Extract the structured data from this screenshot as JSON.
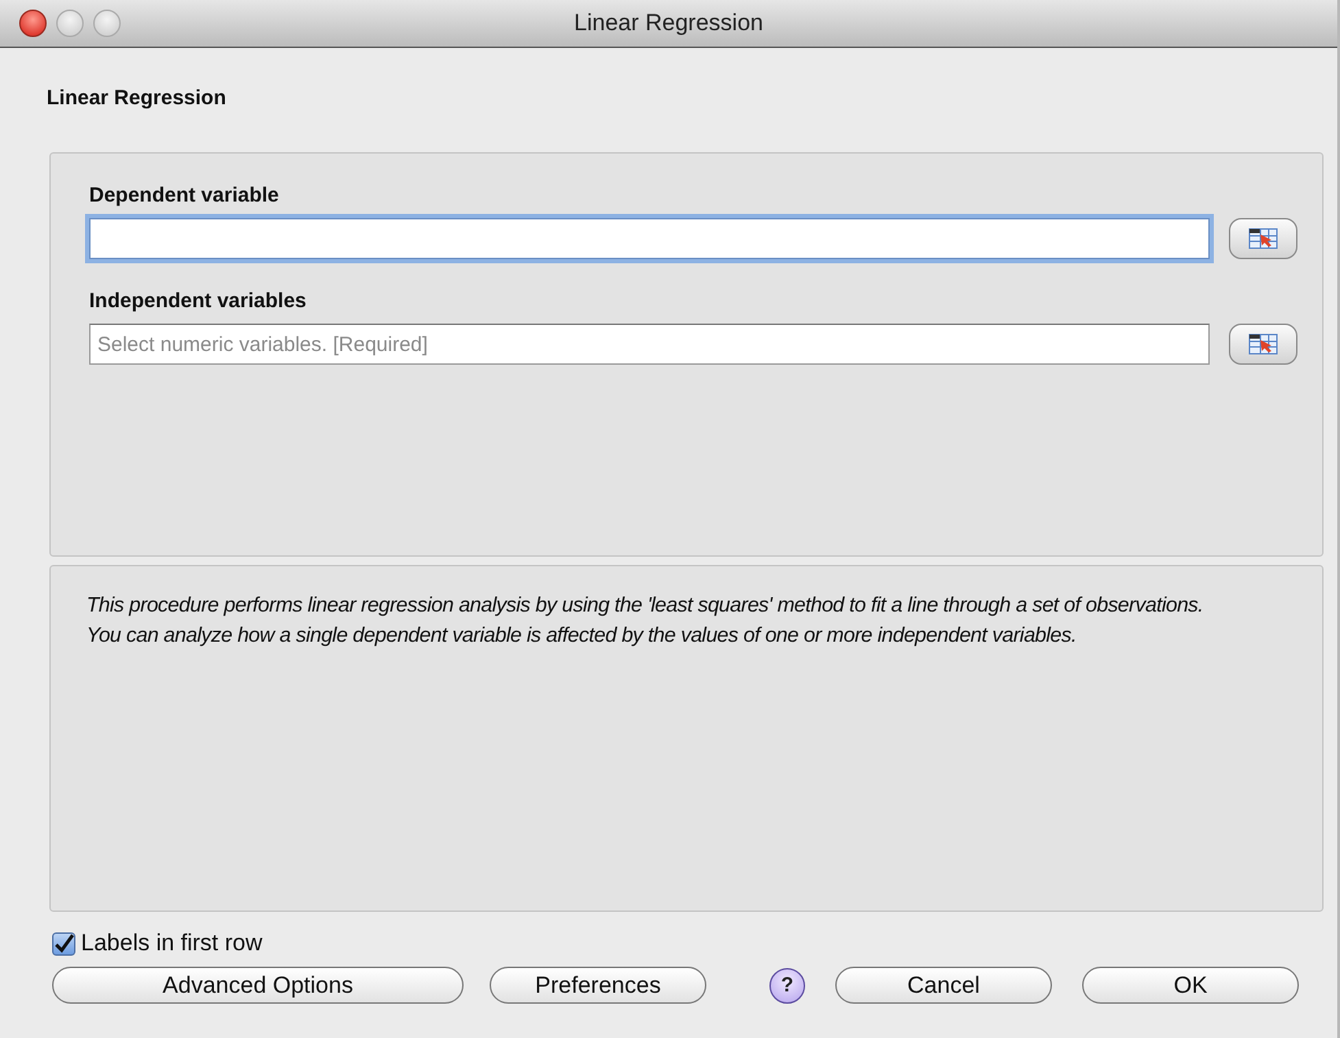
{
  "window": {
    "title": "Linear Regression"
  },
  "heading": "Linear Regression",
  "fields": [
    {
      "label": "Dependent variable",
      "focused": true
    },
    {
      "label": "Independent variables",
      "placeholder": "Select numeric variables. [Required]",
      "focused": false
    }
  ],
  "description": "This procedure performs linear regression analysis by using the 'least squares' method to fit a line through a set of observations. You can analyze how a single dependent variable is affected by the values of one or more independent variables.",
  "labels_checkbox": {
    "label": "Labels in first row",
    "checked": true
  },
  "help": "?",
  "buttons": [
    {
      "label": "Advanced Options",
      "kind": "wide"
    },
    {
      "label": "Preferences",
      "kind": "medium"
    },
    {
      "label": "Cancel",
      "kind": "medium"
    },
    {
      "label": "OK",
      "kind": "medium"
    }
  ]
}
